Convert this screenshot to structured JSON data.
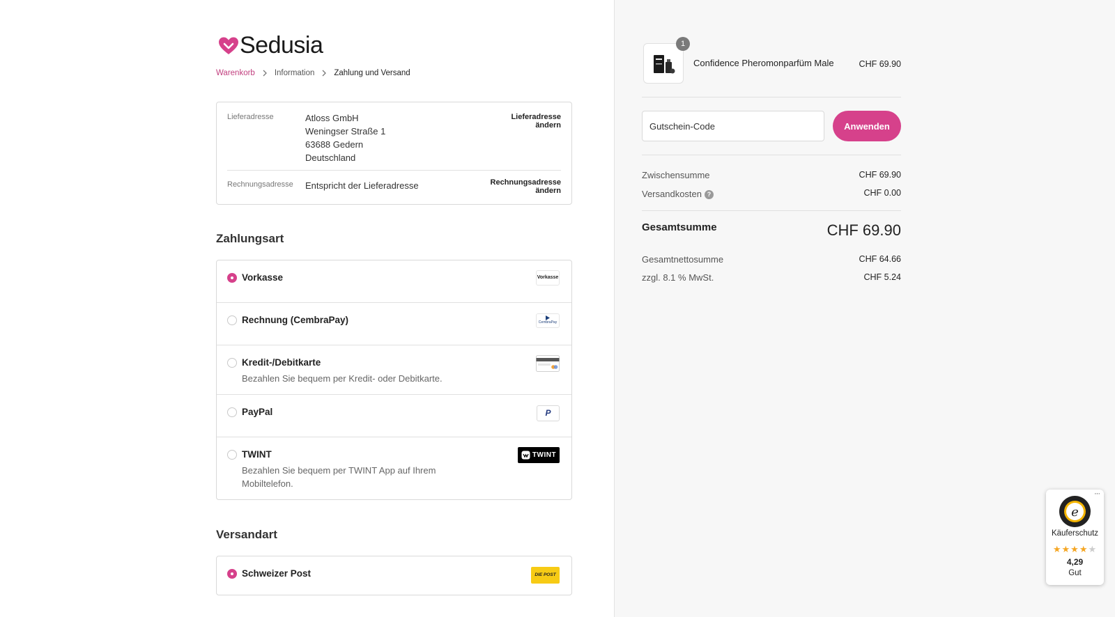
{
  "brand": {
    "name": "Sedusia",
    "accent_color": "#d6418b",
    "logo_icon": "heart-icon"
  },
  "breadcrumb": [
    {
      "label": "Warenkorb"
    },
    {
      "label": "Information"
    },
    {
      "label": "Zahlung und Versand"
    }
  ],
  "address": {
    "shipping_label": "Lieferadresse",
    "shipping_lines": [
      "Atloss GmbH",
      "Weningser Straße 1",
      "63688 Gedern",
      "Deutschland"
    ],
    "shipping_change": [
      "Lieferadresse",
      "ändern"
    ],
    "billing_label": "Rechnungsadresse",
    "billing_value": "Entspricht der Lieferadresse",
    "billing_change": [
      "Rechnungsadresse",
      "ändern"
    ]
  },
  "payment": {
    "title": "Zahlungsart",
    "options": [
      {
        "name": "Vorkasse",
        "selected": true,
        "logo_text": "Vorkasse"
      },
      {
        "name": "Rechnung (CembraPay)",
        "selected": false,
        "logo_text": "CembraPay"
      },
      {
        "name": "Kredit-/Debitkarte",
        "selected": false,
        "description": "Bezahlen Sie bequem per Kredit- oder Debitkarte.",
        "logo_icon": "credit-card-icon"
      },
      {
        "name": "PayPal",
        "selected": false,
        "logo_icon": "paypal-icon"
      },
      {
        "name": "TWINT",
        "selected": false,
        "description": "Bezahlen Sie bequem per TWINT App auf Ihrem Mobiltelefon.",
        "logo_text": "TWINT"
      }
    ]
  },
  "shipping": {
    "title": "Versandart",
    "options": [
      {
        "name": "Schweizer Post",
        "selected": true,
        "logo_text": "DIE POST"
      }
    ]
  },
  "cart": {
    "product_name": "Confidence Pheromonparfüm Male",
    "product_price": "CHF 69.90",
    "quantity": "1"
  },
  "coupon": {
    "placeholder": "Gutschein-Code",
    "apply_label": "Anwenden"
  },
  "summary": {
    "subtotal_label": "Zwischensumme",
    "subtotal_value": "CHF 69.90",
    "shipping_label": "Versandkosten",
    "shipping_value": "CHF 0.00",
    "total_label": "Gesamtsumme",
    "total_value": "CHF 69.90",
    "net_label": "Gesamtnettosumme",
    "net_value": "CHF 64.66",
    "vat_label": "zzgl. 8.1 % MwSt.",
    "vat_value": "CHF 5.24"
  },
  "trusted_shops": {
    "title": "Käuferschutz",
    "rating": "4,29",
    "rating_value": 4.29,
    "grade": "Gut",
    "menu": "···"
  }
}
